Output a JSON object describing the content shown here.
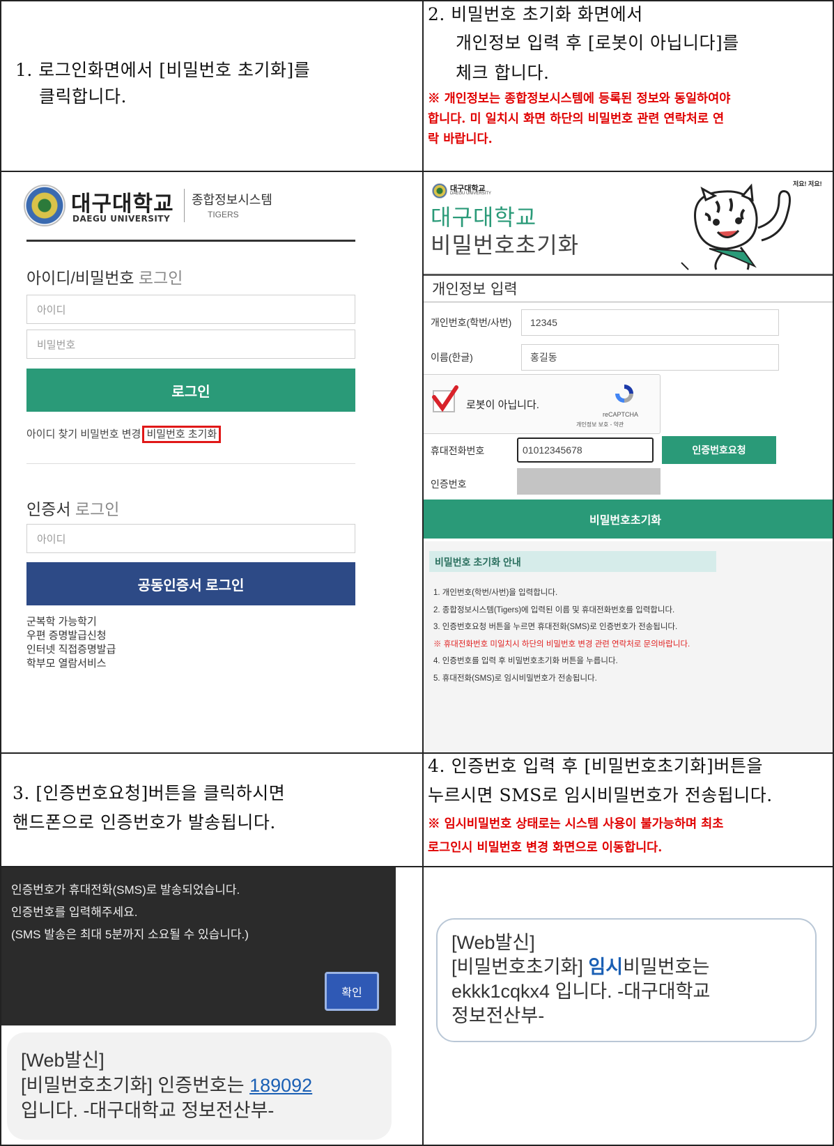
{
  "step1": {
    "line1": "1. 로그인화면에서 [비밀번호 초기화]를",
    "line2": "클릭합니다."
  },
  "step2": {
    "line1": "2. 비밀번호 초기화 화면에서",
    "line2": "개인정보 입력 후 [로봇이 아닙니다]를",
    "line3": "체크 합니다.",
    "note_line1": "※ 개인정보는 종합정보시스템에 등록된 정보와 동일하여야",
    "note_line2": "합니다. 미 일치시 화면 하단의 비밀번호 관련 연락처로 연",
    "note_line3": "락 바랍니다."
  },
  "step3": {
    "line1": "3. [인증번호요청]버튼을 클릭하시면",
    "line2": "핸드폰으로 인증번호가 발송됩니다."
  },
  "step4": {
    "line1": "4. 인증번호 입력 후 [비밀번호초기화]버튼을",
    "line2": "누르시면 SMS로 임시비밀번호가 전송됩니다.",
    "note_line1": "※ 임시비밀번호 상태로는 시스템 사용이 불가능하며 최초",
    "note_line2": "로그인시 비밀번호 변경 화면으로 이동합니다."
  },
  "login": {
    "univ_name": "대구대학교",
    "univ_name_en": "DAEGU UNIVERSITY",
    "system_name": "종합정보시스템",
    "system_sub": "TIGERS",
    "section_title_bold": "아이디/비밀번호",
    "section_title_light": " 로그인",
    "id_placeholder": "아이디",
    "pw_placeholder": "비밀번호",
    "login_button": "로그인",
    "find_id": "아이디 찾기",
    "change_pw": "비밀번호 변경",
    "reset_pw": "비밀번호 초기화",
    "cert_title_bold": "인증서",
    "cert_title_light": " 로그인",
    "cert_id_placeholder": "아이디",
    "cert_login_button": "공동인증서 로그인",
    "links": [
      "군복학 가능학기",
      "우편 증명발급신청",
      "인터넷 직접증명발급",
      "학부모 열람서비스"
    ]
  },
  "reset": {
    "logo_small": "대구대학교",
    "logo_small_en": "DAEGU UNIVERSITY",
    "title_line1": "대구대학교",
    "title_line2": "비밀번호초기화",
    "mascot_caption": "저요! 저요!",
    "section_title": "개인정보 입력",
    "label_id": "개인번호(학번/사번)",
    "value_id": "12345",
    "label_name": "이름(한글)",
    "value_name": "홍길동",
    "captcha_label": "로봇이 아닙니다.",
    "captcha_brand": "reCAPTCHA",
    "captcha_terms": "개인정보 보호 - 약관",
    "label_phone": "휴대전화번호",
    "value_phone": "01012345678",
    "request_button": "인증번호요청",
    "label_code": "인증번호",
    "reset_button": "비밀번호초기화",
    "guide_title": "비밀번호 초기화 안내",
    "guide_items": [
      "1. 개인번호(학번/사번)을 입력합니다.",
      "2. 종합정보시스템(Tigers)에 입력된 이름 및 휴대전화번호를 입력합니다.",
      "3. 인증번호요청 버튼을 누르면 휴대전화(SMS)로 인증번호가 전송됩니다.",
      "※ 휴대전화번호 미일치시 하단의 비밀번호 변경 관련 연락처로 문의바랍니다.",
      "4. 인증번호를 입력 후 비밀번호초기화 버튼을 누릅니다.",
      "5. 휴대전화(SMS)로 임시비밀번호가 전송됩니다."
    ]
  },
  "dialog": {
    "line1": "인증번호가 휴대전화(SMS)로 발송되었습니다.",
    "line2": "인증번호를 입력해주세요.",
    "line3": "(SMS 발송은 최대 5분까지 소요될 수 있습니다.)",
    "ok_button": "확인"
  },
  "sms1": {
    "line1": "[Web발신]",
    "line2_prefix": "[비밀번호초기화] 인증번호는 ",
    "code": "189092",
    "line3": "입니다. -대구대학교 정보전산부-"
  },
  "sms2": {
    "line1": "[Web발신]",
    "line2_prefix": "[비밀번호초기화] ",
    "highlight": "임시",
    "line2_suffix": "비밀번호는",
    "line3": "ekkk1cqkx4 입니다. -대구대학교",
    "line4": "정보전산부-"
  },
  "colors": {
    "green": "#2a9a78",
    "navy": "#2d4a86",
    "note_red": "#e00000",
    "dialog_bg": "#2b2b2b",
    "link_blue": "#1a5fb4"
  }
}
